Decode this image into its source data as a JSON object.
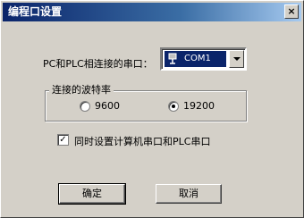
{
  "window": {
    "title": "编程口设置",
    "close_label": "×"
  },
  "port": {
    "label": "PC和PLC相连接的串口：",
    "selected": "COM1",
    "icon": "serial-port-icon"
  },
  "baud": {
    "group_label": "连接的波特率",
    "options": [
      {
        "label": "9600",
        "checked": false
      },
      {
        "label": "19200",
        "checked": true
      }
    ]
  },
  "sync_option": {
    "label": "同时设置计算机串口和PLC串口",
    "checked": true,
    "check_mark": "✓"
  },
  "buttons": {
    "ok": "确定",
    "cancel": "取消"
  }
}
